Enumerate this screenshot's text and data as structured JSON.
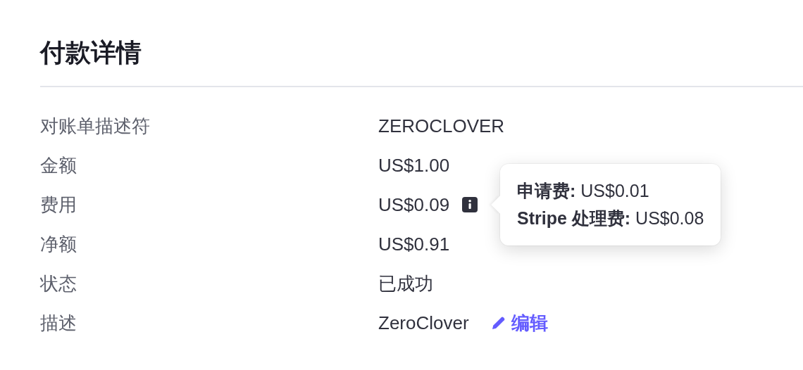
{
  "heading": "付款详情",
  "rows": [
    {
      "label": "对账单描述符",
      "value": "ZEROCLOVER",
      "kind": "plain"
    },
    {
      "label": "金额",
      "value": "US$1.00",
      "kind": "plain"
    },
    {
      "label": "费用",
      "value": "US$0.09",
      "kind": "info"
    },
    {
      "label": "净额",
      "value": "US$0.91",
      "kind": "plain"
    },
    {
      "label": "状态",
      "value": "已成功",
      "kind": "plain"
    },
    {
      "label": "描述",
      "value": "ZeroClover",
      "kind": "edit",
      "action": "编辑"
    }
  ],
  "tooltip": {
    "lines": [
      "**申请费:** US$0.01",
      "**Stripe 处理费:** US$0.08"
    ]
  }
}
